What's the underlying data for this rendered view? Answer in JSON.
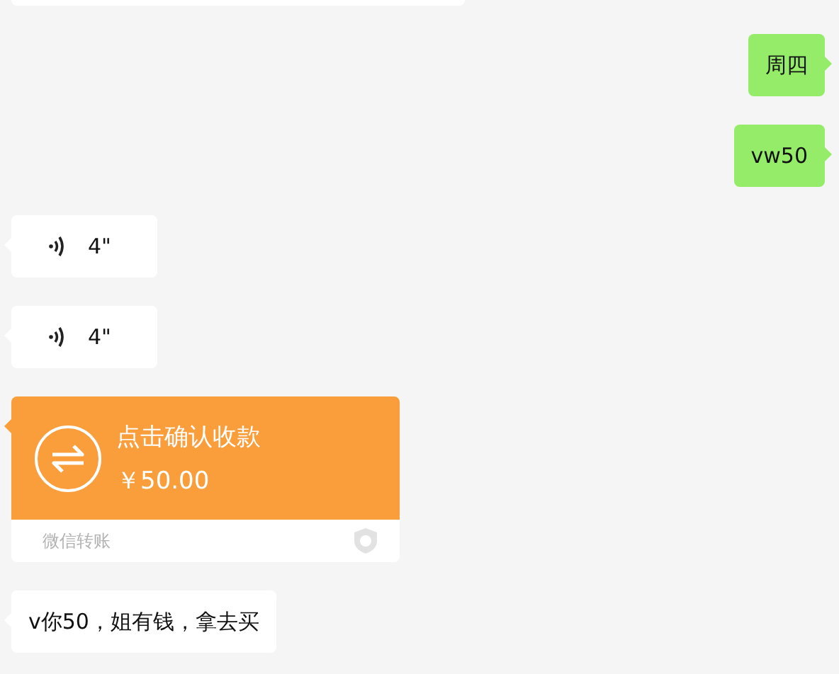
{
  "messages": [
    {
      "kind": "clipped",
      "outgoing": false
    },
    {
      "kind": "text",
      "outgoing": true,
      "text": "周四"
    },
    {
      "kind": "text",
      "outgoing": true,
      "text": "vw50"
    },
    {
      "kind": "voice",
      "outgoing": false,
      "duration": "4\""
    },
    {
      "kind": "voice",
      "outgoing": false,
      "duration": "4\""
    },
    {
      "kind": "transfer",
      "outgoing": false,
      "title": "点击确认收款",
      "amount": "￥50.00",
      "footer": "微信转账"
    },
    {
      "kind": "text",
      "outgoing": false,
      "text": "v你50，姐有钱，拿去买"
    }
  ]
}
